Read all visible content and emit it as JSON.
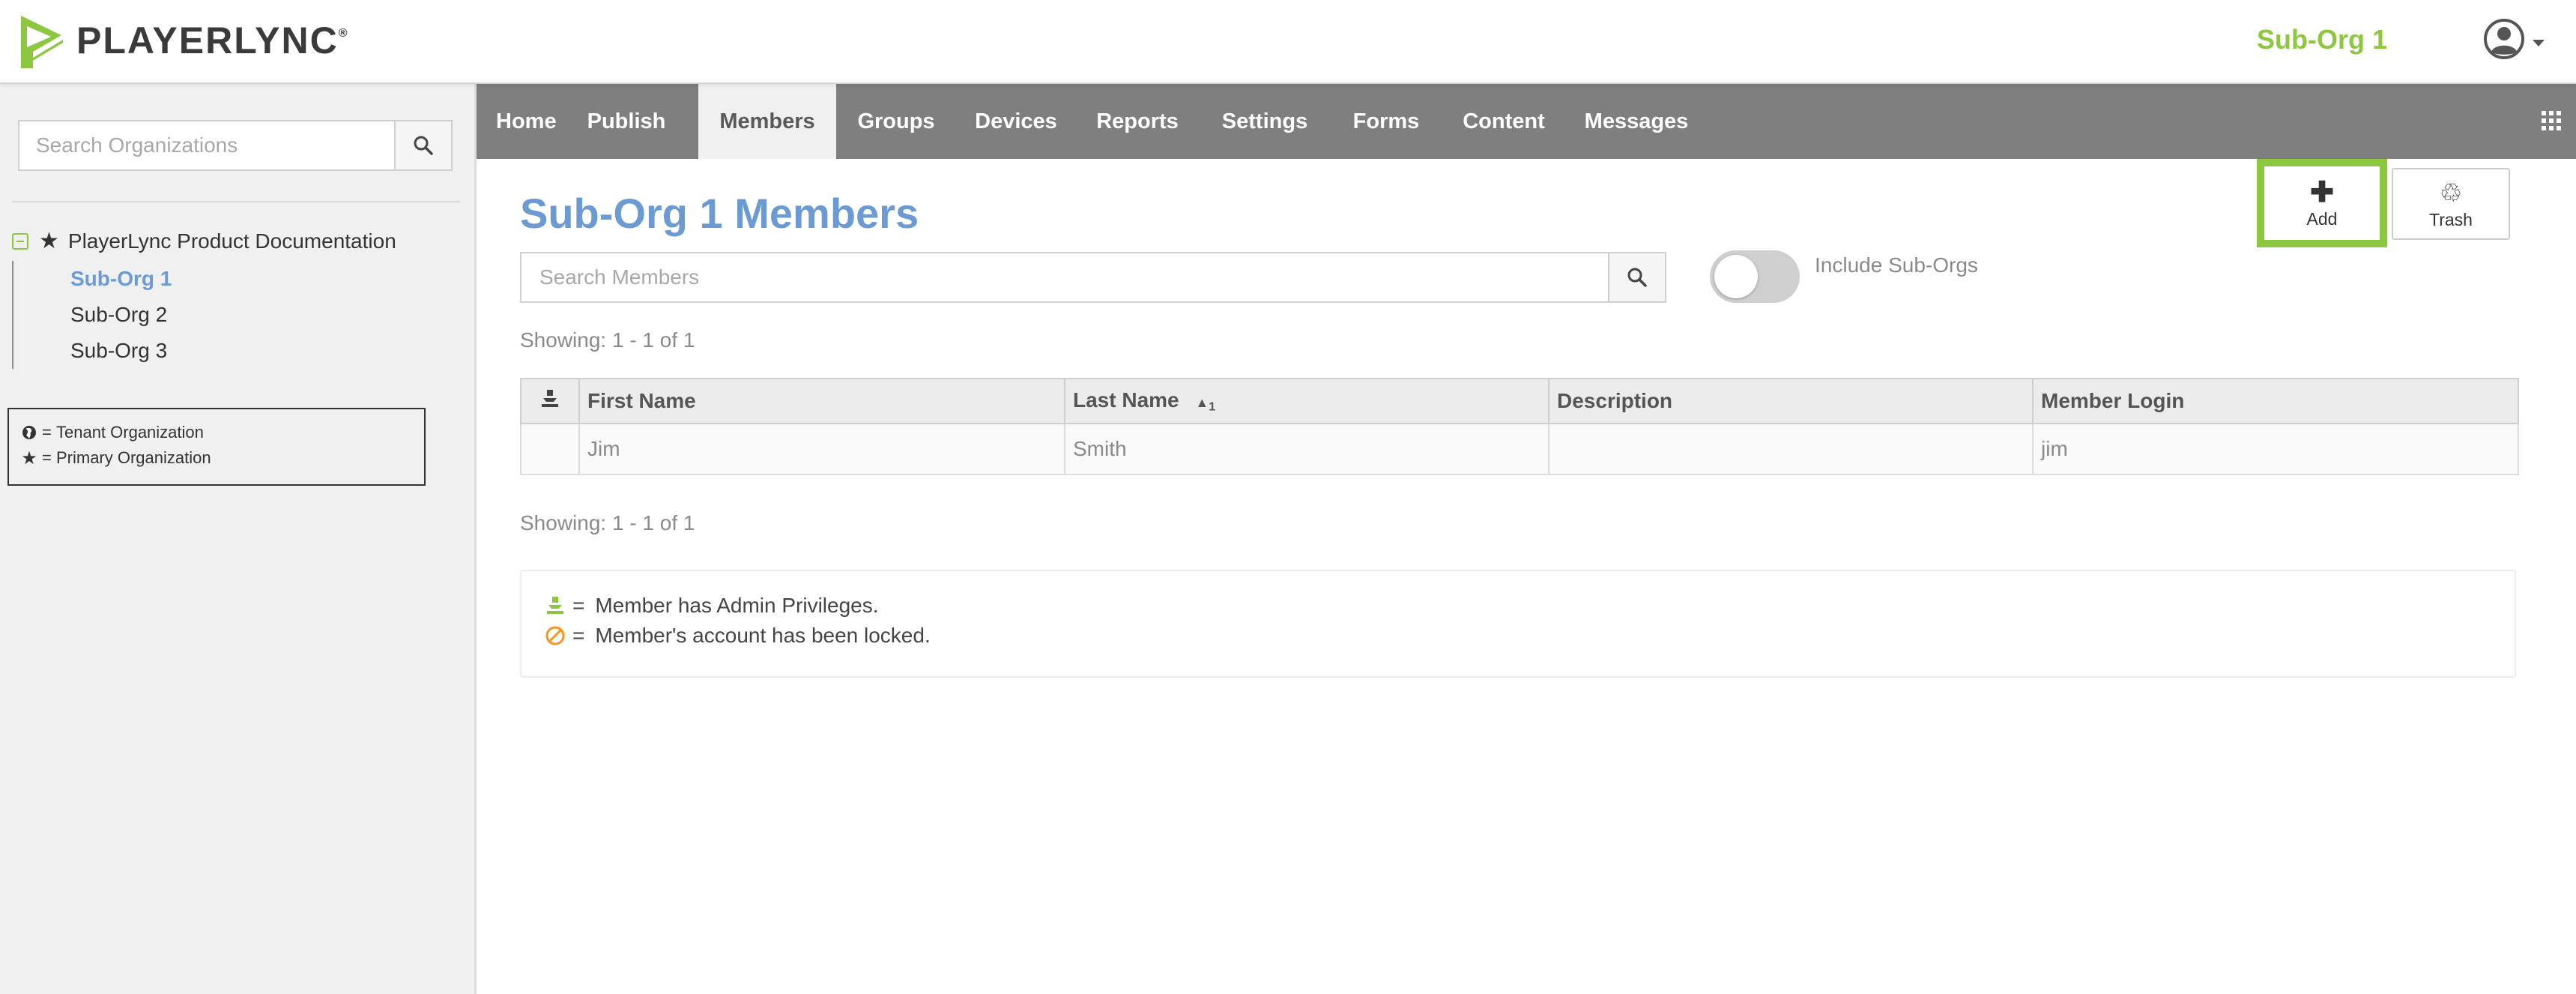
{
  "header": {
    "logo_text": "PLAYERLYNC",
    "logo_reg": "®",
    "org_name": "Sub-Org 1"
  },
  "sidebar": {
    "search_placeholder": "Search Organizations",
    "tree_root": "PlayerLync Product Documentation",
    "tree_children": [
      "Sub-Org 1",
      "Sub-Org 2",
      "Sub-Org 3"
    ],
    "active_child": "Sub-Org 1",
    "legend": [
      {
        "icon": "globe-icon",
        "eq": "=",
        "label": "Tenant Organization"
      },
      {
        "icon": "star-icon",
        "eq": "=",
        "label": "Primary Organization"
      }
    ]
  },
  "nav": {
    "items": [
      "Home",
      "Publish",
      "Members",
      "Groups",
      "Devices",
      "Reports",
      "Settings",
      "Forms",
      "Content",
      "Messages"
    ],
    "active": "Members"
  },
  "main": {
    "title": "Sub-Org 1 Members",
    "add_label": "Add",
    "trash_label": "Trash",
    "search_placeholder": "Search Members",
    "toggle_label": "Include Sub-Orgs",
    "toggle_on": false,
    "showing_top": "Showing: 1 - 1 of 1",
    "showing_bottom": "Showing: 1 - 1 of 1",
    "table": {
      "columns": [
        "First Name",
        "Last Name",
        "Description",
        "Member Login"
      ],
      "sort_indicator": "1",
      "rows": [
        {
          "first": "Jim",
          "last": "Smith",
          "description": "",
          "login": "jim"
        }
      ]
    },
    "legend": [
      {
        "icon": "admin-icon",
        "eq": "=",
        "label": "Member has Admin Privileges."
      },
      {
        "icon": "locked-icon",
        "eq": "=",
        "label": "Member's account has been locked."
      }
    ]
  },
  "colors": {
    "brand_green": "#8dc63f",
    "title_blue": "#6b9bd2",
    "nav_gray": "#7f7f7f",
    "locked_orange": "#f7941d"
  }
}
